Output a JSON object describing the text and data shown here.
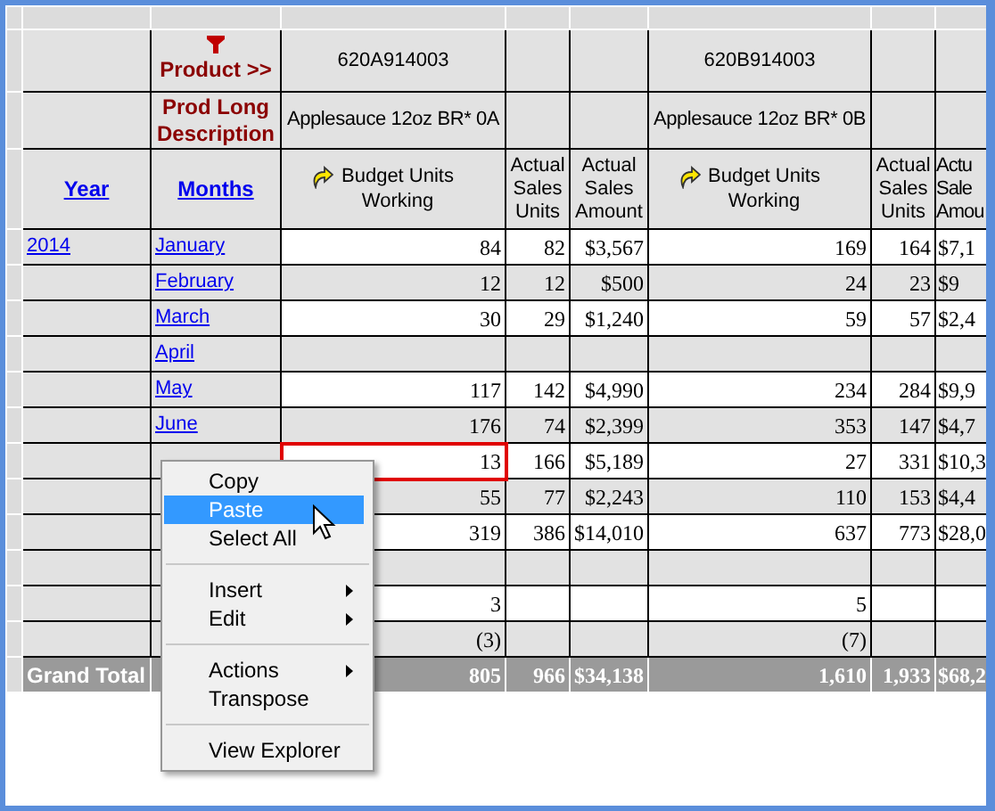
{
  "dimension_labels": {
    "product": "Product >>",
    "description": "Prod Long Description"
  },
  "products": [
    {
      "code": "620A914003",
      "description": "Applesauce 12oz BR* 0A"
    },
    {
      "code": "620B914003",
      "description": "Applesauce 12oz BR* 0B"
    }
  ],
  "columns": {
    "year": "Year",
    "months": "Months",
    "measures": [
      {
        "label": "Budget Units Working",
        "kind": "budget"
      },
      {
        "label": "Actual Sales Units",
        "kind": "actual"
      },
      {
        "label": "Actual Sales Amount",
        "kind": "actual"
      },
      {
        "label": "Budget Units Working",
        "kind": "budget"
      },
      {
        "label": "Actual Sales Units",
        "kind": "actual"
      },
      {
        "label": "Actu Sale Amou",
        "kind": "actual"
      }
    ]
  },
  "rows": [
    {
      "kind": "month",
      "year": "2014",
      "month": "January",
      "cells": [
        {
          "text": "84",
          "selected": false
        },
        {
          "text": "82",
          "selected": false
        },
        {
          "text": "$3,567",
          "selected": false
        },
        {
          "text": "169",
          "selected": false
        },
        {
          "text": "164",
          "selected": false
        },
        {
          "text": "$7,1",
          "selected": false
        }
      ]
    },
    {
      "kind": "month",
      "month": "February",
      "cells": [
        {
          "text": "12",
          "selected": false
        },
        {
          "text": "12",
          "selected": false
        },
        {
          "text": "$500",
          "selected": false
        },
        {
          "text": "24",
          "selected": false
        },
        {
          "text": "23",
          "selected": false
        },
        {
          "text": "$9",
          "selected": false
        }
      ]
    },
    {
      "kind": "month",
      "month": "March",
      "cells": [
        {
          "text": "30",
          "selected": false
        },
        {
          "text": "29",
          "selected": false
        },
        {
          "text": "$1,240",
          "selected": false
        },
        {
          "text": "59",
          "selected": false
        },
        {
          "text": "57",
          "selected": false
        },
        {
          "text": "$2,4",
          "selected": false
        }
      ]
    },
    {
      "kind": "month",
      "month": "April",
      "cells": [
        {
          "selected": false
        },
        {
          "selected": false
        },
        {
          "selected": false
        },
        {
          "selected": false
        },
        {
          "selected": false
        },
        {
          "selected": false
        }
      ]
    },
    {
      "kind": "month",
      "month": "May",
      "cells": [
        {
          "text": "117",
          "selected": false
        },
        {
          "text": "142",
          "selected": false
        },
        {
          "text": "$4,990",
          "selected": false
        },
        {
          "text": "234",
          "selected": false
        },
        {
          "text": "284",
          "selected": false
        },
        {
          "text": "$9,9",
          "selected": false
        }
      ]
    },
    {
      "kind": "month",
      "month": "June",
      "cells": [
        {
          "text": "176",
          "selected": false
        },
        {
          "text": "74",
          "selected": false
        },
        {
          "text": "$2,399",
          "selected": false
        },
        {
          "text": "353",
          "selected": false
        },
        {
          "text": "147",
          "selected": false
        },
        {
          "text": "$4,7",
          "selected": false
        }
      ]
    },
    {
      "kind": "month",
      "cells": [
        {
          "text": "13",
          "selected": true
        },
        {
          "text": "166",
          "selected": false
        },
        {
          "text": "$5,189",
          "selected": false
        },
        {
          "text": "27",
          "selected": false
        },
        {
          "text": "331",
          "selected": false
        },
        {
          "text": "$10,3",
          "selected": false
        }
      ]
    },
    {
      "kind": "month",
      "cells": [
        {
          "text": "55",
          "selected": false
        },
        {
          "text": "77",
          "selected": false
        },
        {
          "text": "$2,243",
          "selected": false
        },
        {
          "text": "110",
          "selected": false
        },
        {
          "text": "153",
          "selected": false
        },
        {
          "text": "$4,4",
          "selected": false
        }
      ]
    },
    {
      "kind": "month",
      "cells": [
        {
          "text": "319",
          "selected": false
        },
        {
          "text": "386",
          "selected": false
        },
        {
          "text": "$14,010",
          "selected": false
        },
        {
          "text": "637",
          "selected": false
        },
        {
          "text": "773",
          "selected": false
        },
        {
          "text": "$28,0",
          "selected": false
        }
      ]
    },
    {
      "kind": "month",
      "cells": [
        {
          "selected": false
        },
        {
          "selected": false
        },
        {
          "selected": false
        },
        {
          "selected": false
        },
        {
          "selected": false
        },
        {
          "selected": false
        }
      ]
    },
    {
      "kind": "month",
      "cells": [
        {
          "text": "3",
          "selected": false
        },
        {
          "selected": false
        },
        {
          "selected": false
        },
        {
          "text": "5",
          "selected": false
        },
        {
          "selected": false
        },
        {
          "selected": false
        }
      ]
    },
    {
      "kind": "month",
      "cells": [
        {
          "text": "(3)",
          "selected": false
        },
        {
          "selected": false
        },
        {
          "selected": false
        },
        {
          "text": "(7)",
          "selected": false
        },
        {
          "selected": false
        },
        {
          "selected": false
        }
      ]
    },
    {
      "kind": "total",
      "label": "Grand Total",
      "cells": [
        {
          "text": "805",
          "selected": false
        },
        {
          "text": "966",
          "selected": false
        },
        {
          "text": "$34,138",
          "selected": false
        },
        {
          "text": "1,610",
          "selected": false
        },
        {
          "text": "1,933",
          "selected": false
        },
        {
          "text": "$68,2",
          "selected": false
        }
      ]
    }
  ],
  "context_menu": {
    "items": [
      {
        "kind": "item",
        "label": "Copy",
        "selected": false,
        "submenu": false
      },
      {
        "kind": "item",
        "label": "Paste",
        "selected": true,
        "submenu": false
      },
      {
        "kind": "item",
        "label": "Select All",
        "selected": false,
        "submenu": false
      },
      {
        "kind": "separator"
      },
      {
        "kind": "item",
        "label": "Insert",
        "selected": false,
        "submenu": true
      },
      {
        "kind": "item",
        "label": "Edit",
        "selected": false,
        "submenu": true
      },
      {
        "kind": "separator"
      },
      {
        "kind": "item",
        "label": "Actions",
        "selected": false,
        "submenu": true
      },
      {
        "kind": "item",
        "label": "Transpose",
        "selected": false,
        "submenu": false
      },
      {
        "kind": "separator"
      },
      {
        "kind": "item",
        "label": "View Explorer",
        "selected": false,
        "submenu": false
      }
    ]
  }
}
